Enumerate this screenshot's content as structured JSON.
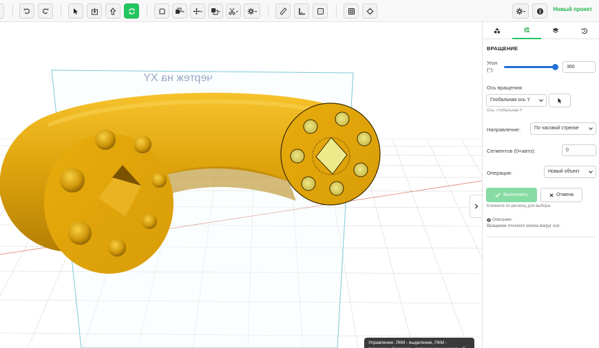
{
  "toolbar": {
    "project_name": "Новый проект",
    "icons": [
      "undo-icon",
      "redo-icon",
      "select-icon",
      "import-icon",
      "export-icon",
      "rotate-icon",
      "sketch-icon",
      "extrude-icon",
      "move-icon",
      "boolean-icon",
      "cut-icon",
      "settings-icon",
      "ruler-icon",
      "angle-icon",
      "box-icon",
      "grid-icon",
      "target-icon",
      "gear-icon",
      "info-icon"
    ]
  },
  "viewport": {
    "plane_label": "чертеж на XY",
    "hint": "Управление: ЛКМ - выделение, ПКМ - вращение, Колесико - перемещение камеры S - масштабирование R - вращение",
    "colors": {
      "model": "#e5ac10",
      "grid": "#d6d6d6",
      "plane": "#7cc8d4"
    }
  },
  "panel": {
    "tabs": [
      "shapes-icon",
      "params-icon",
      "layers-icon",
      "history-icon"
    ],
    "title": "ВРАЩЕНИЕ",
    "angle_label": "Угол (°):",
    "angle_value": "360",
    "angle_level": 1.0,
    "axis_label": "Ось вращения:",
    "axis_value": "Глобальная ось Y",
    "axis_note": "Ось: глобальная Y",
    "direction_label": "Направление:",
    "direction_value": "По часовой стрелке",
    "segments_label": "Сегментов (0=авто):",
    "segments_value": "0",
    "operation_label": "Операция:",
    "operation_value": "Новый объект",
    "run_label": "Выполнить",
    "cancel_label": "Отмена",
    "region_hint": "Кликните по региону для выбора",
    "desc_title": "Описание:",
    "desc_text": "Вращение плоского эскиза вокруг оси."
  }
}
